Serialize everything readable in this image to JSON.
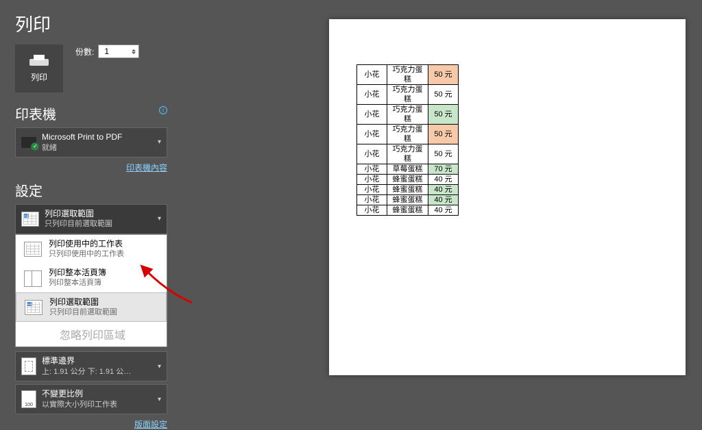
{
  "page_title": "列印",
  "print_button_label": "列印",
  "copies": {
    "label": "份數:",
    "value": "1"
  },
  "printer": {
    "section": "印表機",
    "name": "Microsoft Print to PDF",
    "status": "就緒",
    "props_link": "印表機內容"
  },
  "settings": {
    "section": "設定",
    "what": {
      "title": "列印選取範圍",
      "sub": "只列印目前選取範圍",
      "options": [
        {
          "title": "列印使用中的工作表",
          "sub": "只列印使用中的工作表"
        },
        {
          "title": "列印整本活頁簿",
          "sub": "列印整本活頁簿"
        },
        {
          "title": "列印選取範圍",
          "sub": "只列印目前選取範圍",
          "selected": true
        }
      ],
      "disabled": "忽略列印區域"
    },
    "margins": {
      "title": "標準邊界",
      "sub": "上: 1.91 公分 下: 1.91 公…"
    },
    "scaling": {
      "title": "不變更比例",
      "sub": "以實際大小列印工作表"
    },
    "page_setup_link": "版面設定"
  },
  "preview_rows": [
    {
      "a": "小花",
      "b": "巧克力蛋糕",
      "c": "50 元",
      "hl": "o"
    },
    {
      "a": "小花",
      "b": "巧克力蛋糕",
      "c": "50 元"
    },
    {
      "a": "小花",
      "b": "巧克力蛋糕",
      "c": "50 元",
      "hl": "g"
    },
    {
      "a": "小花",
      "b": "巧克力蛋糕",
      "c": "50 元",
      "hl": "o"
    },
    {
      "a": "小花",
      "b": "巧克力蛋糕",
      "c": "50 元"
    },
    {
      "a": "小花",
      "b": "草莓蛋糕",
      "c": "70 元",
      "hl": "g"
    },
    {
      "a": "小花",
      "b": "蜂蜜蛋糕",
      "c": "40 元"
    },
    {
      "a": "小花",
      "b": "蜂蜜蛋糕",
      "c": "40 元",
      "hl": "g"
    },
    {
      "a": "小花",
      "b": "蜂蜜蛋糕",
      "c": "40 元",
      "hl": "g"
    },
    {
      "a": "小花",
      "b": "蜂蜜蛋糕",
      "c": "40 元"
    }
  ]
}
